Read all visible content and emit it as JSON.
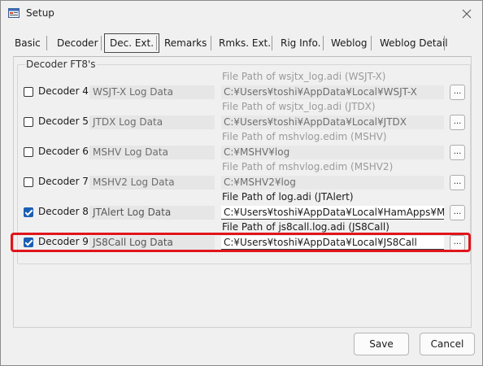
{
  "window": {
    "title": "Setup"
  },
  "tabs": [
    {
      "label": "Basic"
    },
    {
      "label": "Decoder"
    },
    {
      "label": "Dec. Ext."
    },
    {
      "label": "Remarks"
    },
    {
      "label": "Rmks. Ext."
    },
    {
      "label": "Rig Info."
    },
    {
      "label": "Weblog"
    },
    {
      "label": "Weblog Detail"
    }
  ],
  "active_tab": "Dec. Ext.",
  "group": {
    "title": "Decoder FT8's"
  },
  "decoders": [
    {
      "label": "Decoder 4",
      "checked": false,
      "log_label": "WSJT-X Log Data",
      "path_caption": "File Path of wsjtx_log.adi (WSJT-X)",
      "path_value": "C:¥Users¥toshi¥AppData¥Local¥WSJT-X",
      "browse": "...",
      "enabled": false
    },
    {
      "label": "Decoder 5",
      "checked": false,
      "log_label": "JTDX Log Data",
      "path_caption": "File Path of wsjtx_log.adi (JTDX)",
      "path_value": "C:¥Users¥toshi¥AppData¥Local¥JTDX",
      "browse": "...",
      "enabled": false
    },
    {
      "label": "Decoder 6",
      "checked": false,
      "log_label": "MSHV Log Data",
      "path_caption": "File Path of mshvlog.edim (MSHV)",
      "path_value": "C:¥MSHV¥log",
      "browse": "...",
      "enabled": false
    },
    {
      "label": "Decoder 7",
      "checked": false,
      "log_label": "MSHV2 Log Data",
      "path_caption": "File Path of mshvlog.edim (MSHV2)",
      "path_value": "C:¥MSHV2¥log",
      "browse": "...",
      "enabled": false
    },
    {
      "label": "Decoder 8",
      "checked": true,
      "log_label": "JTAlert Log Data",
      "path_caption": "File Path of log.adi (JTAlert)",
      "path_value": "C:¥Users¥toshi¥AppData¥Local¥HamApps¥My Call¥l",
      "browse": "...",
      "enabled": true
    },
    {
      "label": "Decoder 9",
      "checked": true,
      "log_label": "JS8Call Log Data",
      "path_caption": "File Path of js8call.log.adi (JS8Call)",
      "path_value": "C:¥Users¥toshi¥AppData¥Local¥JS8Call",
      "browse": "...",
      "enabled": true
    }
  ],
  "buttons": {
    "save": "Save",
    "cancel": "Cancel"
  },
  "colors": {
    "accent": "#1a5fb4",
    "highlight": "#e0151c"
  }
}
